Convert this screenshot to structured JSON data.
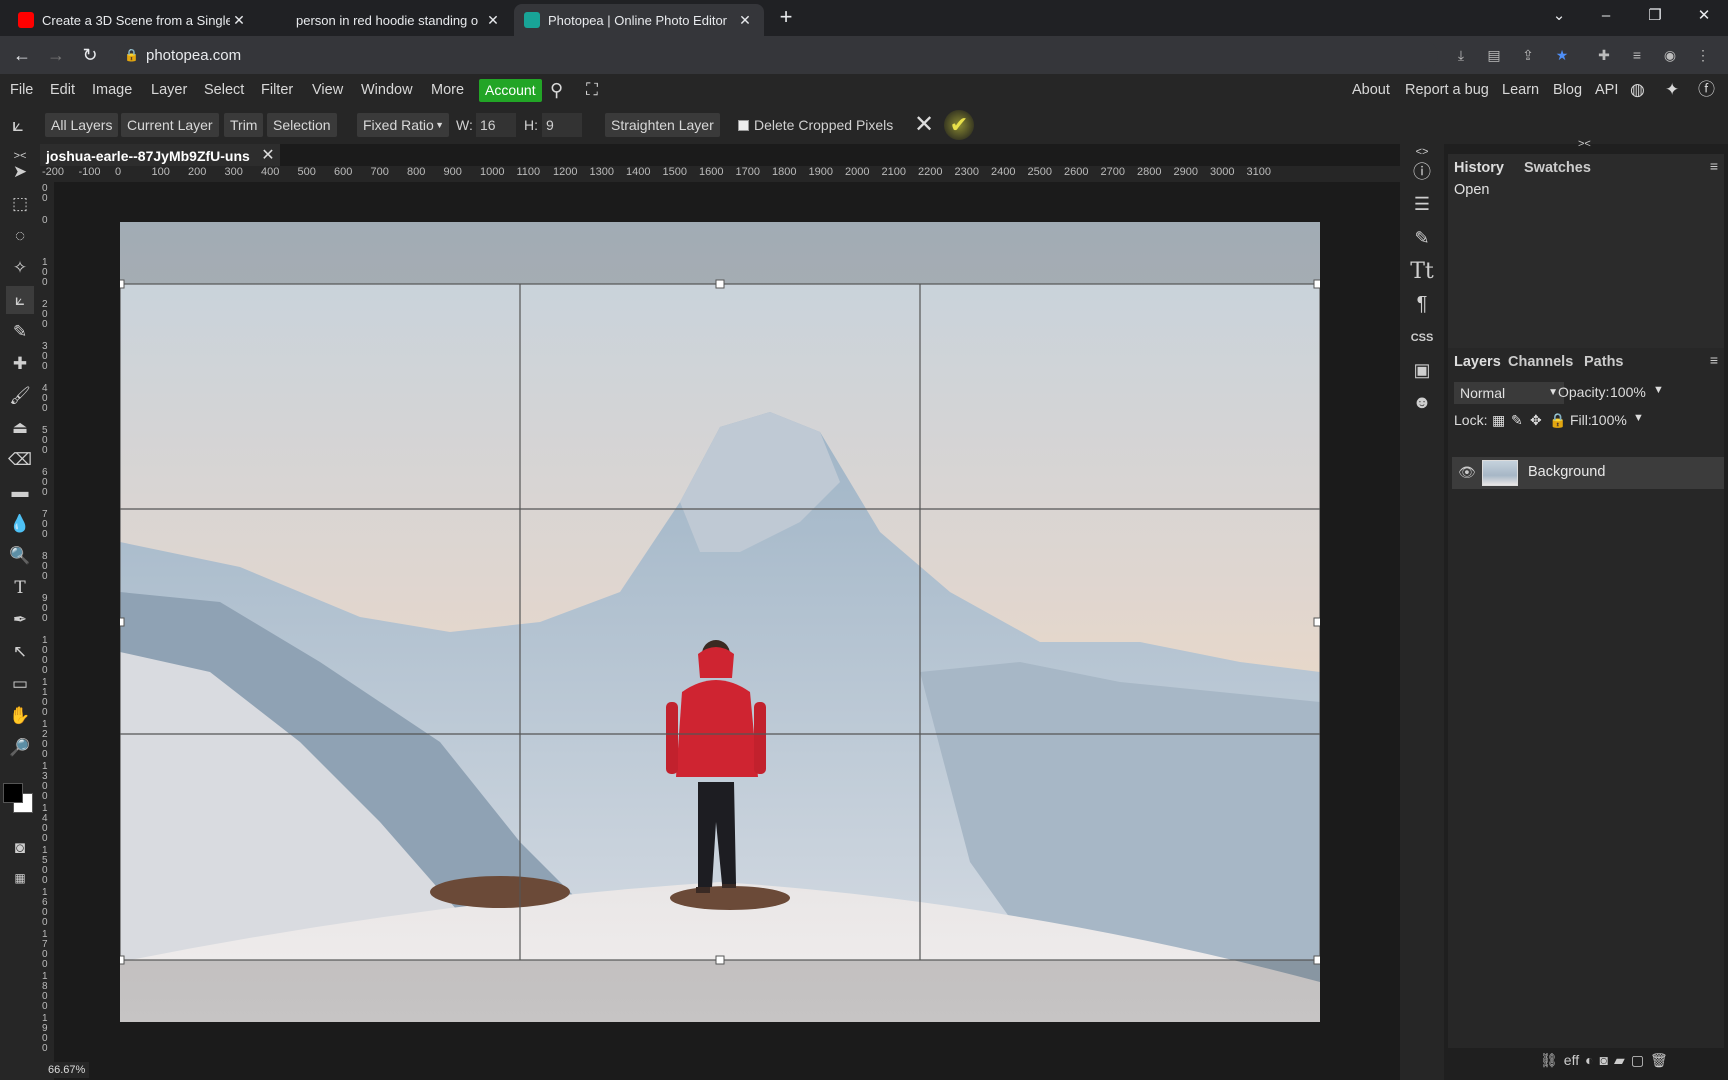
{
  "browser": {
    "tabs": [
      {
        "title": "Create a 3D Scene from a Single",
        "favicon_color": "#ff0000",
        "active": false
      },
      {
        "title": "person in red hoodie standing o",
        "favicon_color": "#4a4a4a",
        "active": false
      },
      {
        "title": "Photopea | Online Photo Editor",
        "favicon_color": "#18a497",
        "active": true
      }
    ],
    "new_tab": "+",
    "window_controls": [
      "⌄",
      "–",
      "❐",
      "✕"
    ],
    "url": "photopea.com",
    "nav": {
      "back": "←",
      "forward": "→",
      "reload": "↻"
    },
    "extensions": [
      "⤓",
      "▤",
      "⇪",
      "★",
      "✚",
      "≡",
      "◉",
      "⋮"
    ]
  },
  "menu": {
    "items": [
      "File",
      "Edit",
      "Image",
      "Layer",
      "Select",
      "Filter",
      "View",
      "Window",
      "More"
    ],
    "account": "Account",
    "right_items": [
      "About",
      "Report a bug",
      "Learn",
      "Blog",
      "API"
    ],
    "account_color": "#22a526"
  },
  "options": {
    "all_layers": "All Layers",
    "current_layer": "Current Layer",
    "trim": "Trim",
    "selection": "Selection",
    "ratio_mode": "Fixed Ratio",
    "w_label": "W:",
    "w_value": "16",
    "h_label": "H:",
    "h_value": "9",
    "straighten": "Straighten Layer",
    "delete_cropped": "Delete Cropped Pixels",
    "cancel": "✕",
    "commit": "✔"
  },
  "document": {
    "tab_title": "joshua-earle--87JyMb9ZfU-uns",
    "close": "✕",
    "zoom": "66.67%",
    "ruler_h": [
      "-200",
      "-100",
      "0",
      "100",
      "200",
      "300",
      "400",
      "500",
      "600",
      "700",
      "800",
      "900",
      "1000",
      "1100",
      "1200",
      "1300",
      "1400",
      "1500",
      "1600",
      "1700",
      "1800",
      "1900",
      "2000",
      "2100",
      "2200",
      "2300",
      "2400",
      "2500",
      "2600",
      "2700",
      "2800",
      "2900",
      "3000",
      "3100"
    ],
    "ruler_v": [
      "100",
      "0",
      "100",
      "200",
      "300",
      "400",
      "500",
      "600",
      "700",
      "800",
      "900",
      "1000",
      "1100",
      "1200",
      "1300",
      "1400",
      "1500",
      "1600",
      "1700",
      "1800",
      "1900"
    ]
  },
  "panels": {
    "history_tab": "History",
    "swatches_tab": "Swatches",
    "history_items": [
      "Open"
    ],
    "layers_tab": "Layers",
    "channels_tab": "Channels",
    "paths_tab": "Paths",
    "blend_mode": "Normal",
    "opacity_label": "Opacity:",
    "opacity_value": "100%",
    "lock_label": "Lock:",
    "fill_label": "Fill:",
    "fill_value": "100%",
    "layer_name": "Background",
    "menu_icon": "≡",
    "collapse_left": "<>",
    "collapse_right": "><",
    "css_label": "CSS"
  }
}
